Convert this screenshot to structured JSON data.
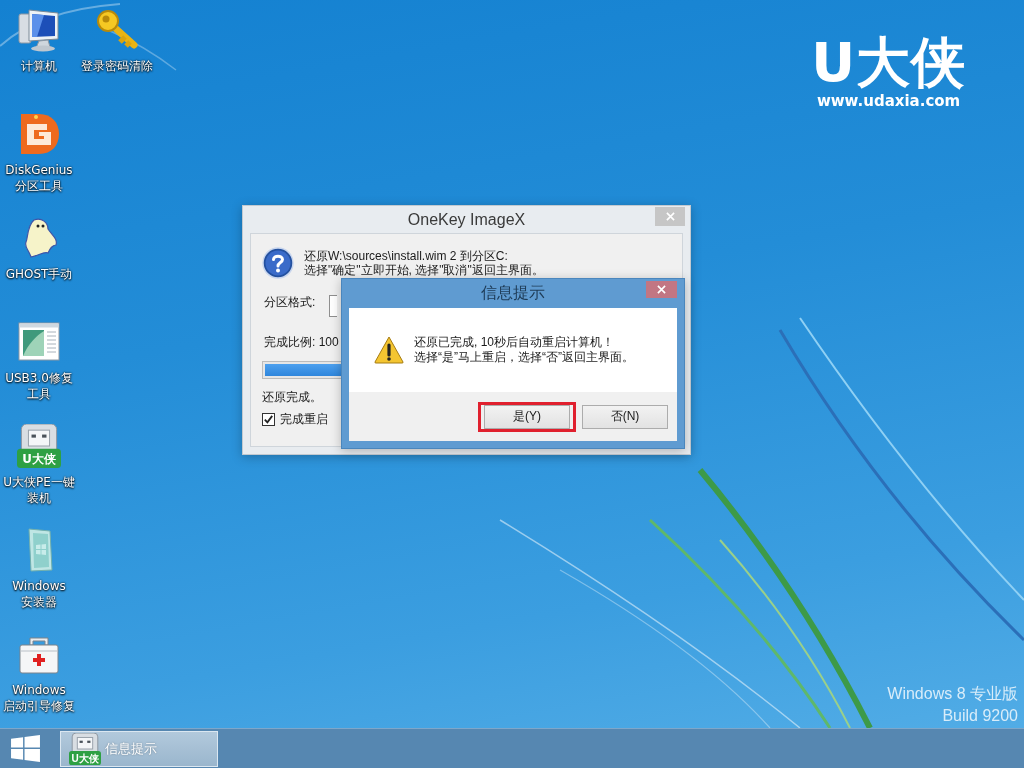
{
  "desktop": {
    "icons": [
      {
        "label": [
          "计算机"
        ],
        "kind": "computer"
      },
      {
        "label": [
          "DiskGenius",
          "分区工具"
        ],
        "kind": "d-letter"
      },
      {
        "label": [
          "GHOST手动"
        ],
        "kind": "ghost"
      },
      {
        "label": [
          "USB3.0修复",
          "工具"
        ],
        "kind": "window"
      },
      {
        "label": [
          "U大侠PE一键",
          "装机"
        ],
        "kind": "usb-drive",
        "badge": "U大侠"
      },
      {
        "label": [
          "Windows",
          "安装器"
        ],
        "kind": "installer"
      },
      {
        "label": [
          "Windows",
          "启动引导修复"
        ],
        "kind": "first-aid"
      },
      {
        "label": [
          "登录密码清除"
        ],
        "kind": "key"
      }
    ],
    "logo": {
      "name": "U大侠",
      "url": "www.udaxia.com"
    },
    "edition": [
      "Windows 8 专业版",
      "Build 9200"
    ]
  },
  "onekey_window": {
    "title": "OneKey ImageX",
    "active": false,
    "message": [
      "还原W:\\sources\\install.wim 2 到分区C:",
      "选择\"确定\"立即开始, 选择\"取消\"返回主界面。"
    ],
    "format_label": "分区格式:",
    "progress_label": "完成比例: 100",
    "progress": {
      "level": 1
    },
    "status": "还原完成。",
    "restart_checkbox": {
      "label": "完成重启",
      "checked": true
    }
  },
  "message_dialog": {
    "title": "信息提示",
    "active": true,
    "message": [
      "还原已完成, 10秒后自动重启计算机！",
      "选择“是”马上重启，选择“否”返回主界面。"
    ],
    "buttons": [
      {
        "label": "是(Y)",
        "highlighted": true
      },
      {
        "label": "否(N)",
        "highlighted": false
      }
    ]
  },
  "taskbar": {
    "tasks": [
      {
        "label": "信息提示",
        "badge": "U大侠",
        "selected": true
      }
    ]
  }
}
